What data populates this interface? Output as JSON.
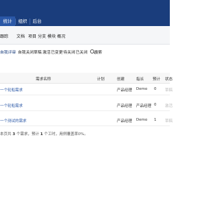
{
  "top_tabs": [
    {
      "label": "统计",
      "active": true
    },
    {
      "label": "组织",
      "active": false
    },
    {
      "label": "后台",
      "active": false
    }
  ],
  "sub_nav": [
    "跟踪",
    "文档",
    "项目",
    "分支",
    "模块",
    "概况"
  ],
  "filters": [
    "自我评审",
    "自我关闭",
    "草稿",
    "激活",
    "已变更",
    "待关闭",
    "已关闭"
  ],
  "search_label": "搜索",
  "table": {
    "columns": [
      "需求名称",
      "计划",
      "创建",
      "指派",
      "预计",
      "状态"
    ],
    "rows": [
      {
        "name": "一个轮船需求",
        "plan": "",
        "creator": "产品经理",
        "assignee": "Demo",
        "estimate": "0",
        "status": "草稿"
      },
      {
        "name": "一个轮船需求",
        "plan": "",
        "creator": "产品经理",
        "assignee": "产品经理",
        "estimate": "0",
        "status": "激活"
      },
      {
        "name": "一个测试的需求",
        "plan": "",
        "creator": "产品经理",
        "assignee": "Demo",
        "estimate": "1",
        "status": "草稿"
      }
    ]
  },
  "summary": {
    "prefix": "本页共 ",
    "count": "3",
    "middle": " 个需求，预计 ",
    "hours": "1",
    "suffix": " 个工时，用例覆盖率0%。"
  }
}
